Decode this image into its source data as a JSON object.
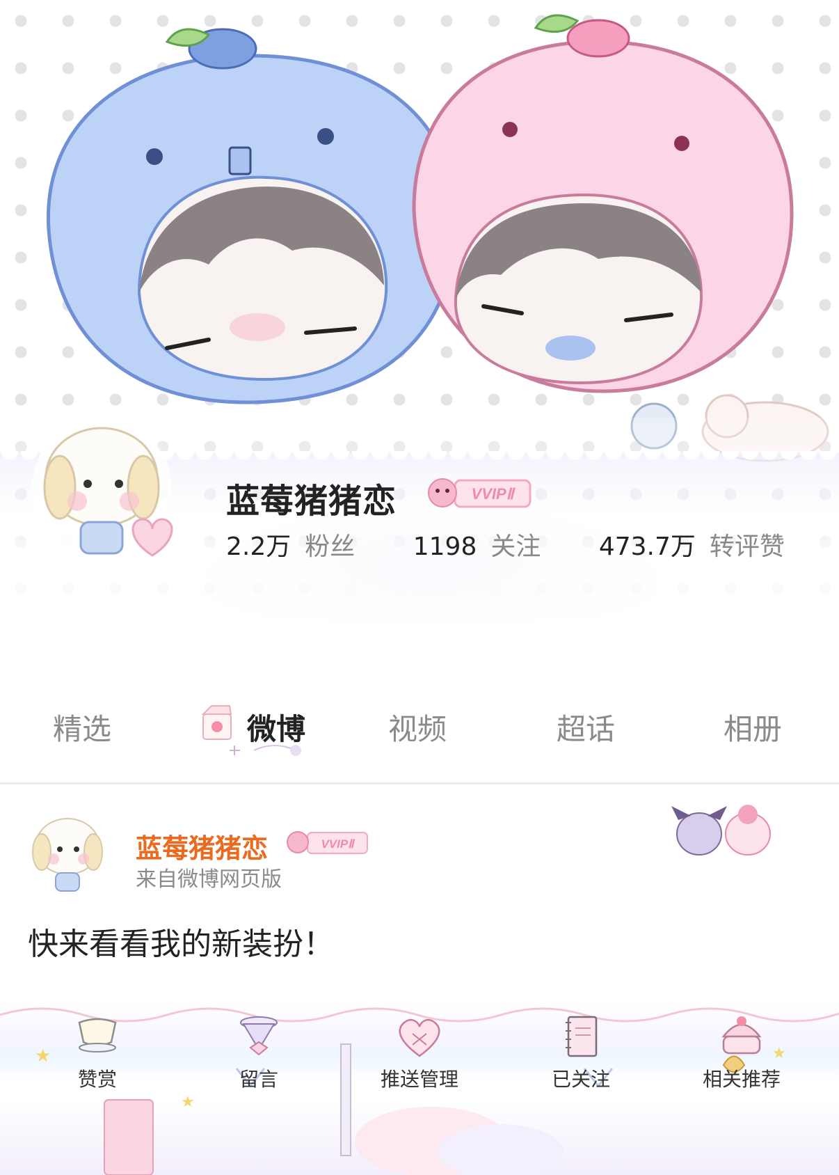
{
  "profile": {
    "username": "蓝莓猪猪恋",
    "badge": "VVIPⅡ",
    "stats": [
      {
        "value": "2.2万",
        "label": "粉丝"
      },
      {
        "value": "1198",
        "label": "关注"
      },
      {
        "value": "473.7万",
        "label": "转评赞"
      }
    ]
  },
  "tabs": [
    {
      "label": "精选",
      "active": false
    },
    {
      "label": "微博",
      "active": true
    },
    {
      "label": "视频",
      "active": false
    },
    {
      "label": "超话",
      "active": false
    },
    {
      "label": "相册",
      "active": false
    }
  ],
  "post": {
    "username": "蓝莓猪猪恋",
    "badge": "VVIPⅡ",
    "source": "来自微博网页版",
    "text": "快来看看我的新装扮！"
  },
  "actions": [
    {
      "label": "赞赏",
      "icon": "teacup-icon"
    },
    {
      "label": "留言",
      "icon": "bow-cup-icon"
    },
    {
      "label": "推送管理",
      "icon": "heart-frame-icon"
    },
    {
      "label": "已关注",
      "icon": "notebook-icon"
    },
    {
      "label": "相关推荐",
      "icon": "cake-icon"
    }
  ],
  "colors": {
    "accent_username": "#ea6b1f",
    "blueberry": "#b9d0f5",
    "peach": "#fbd3e4",
    "badge_pink": "#f7b8cc"
  }
}
